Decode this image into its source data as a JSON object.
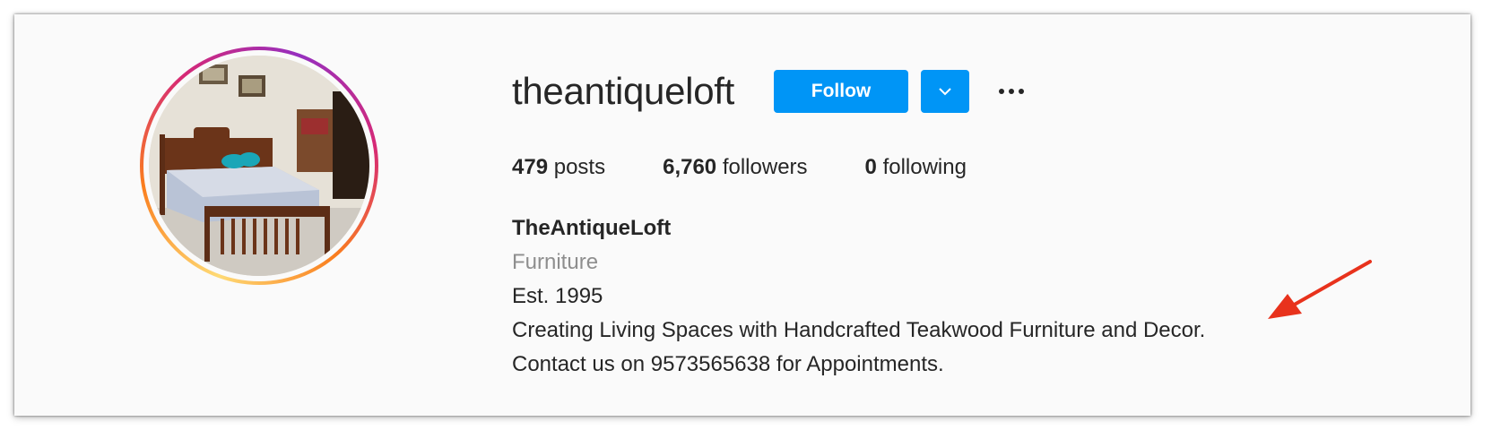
{
  "profile": {
    "username": "theantiqueloft",
    "follow_label": "Follow",
    "dropdown_icon": "chevron-down-icon",
    "more_icon": "more-options-icon",
    "avatar_alt": "profile picture"
  },
  "stats": {
    "posts_count": "479",
    "posts_label": "posts",
    "followers_count": "6,760",
    "followers_label": "followers",
    "following_count": "0",
    "following_label": "following"
  },
  "bio": {
    "full_name": "TheAntiqueLoft",
    "category": "Furniture",
    "lines": [
      "Est. 1995",
      "Creating Living Spaces with Handcrafted Teakwood Furniture and Decor.",
      "Contact us on 9573565638 for Appointments."
    ]
  },
  "colors": {
    "accent": "#0095f6",
    "text": "#262626",
    "muted": "#8e8e8e",
    "annotation": "#e8321c"
  }
}
